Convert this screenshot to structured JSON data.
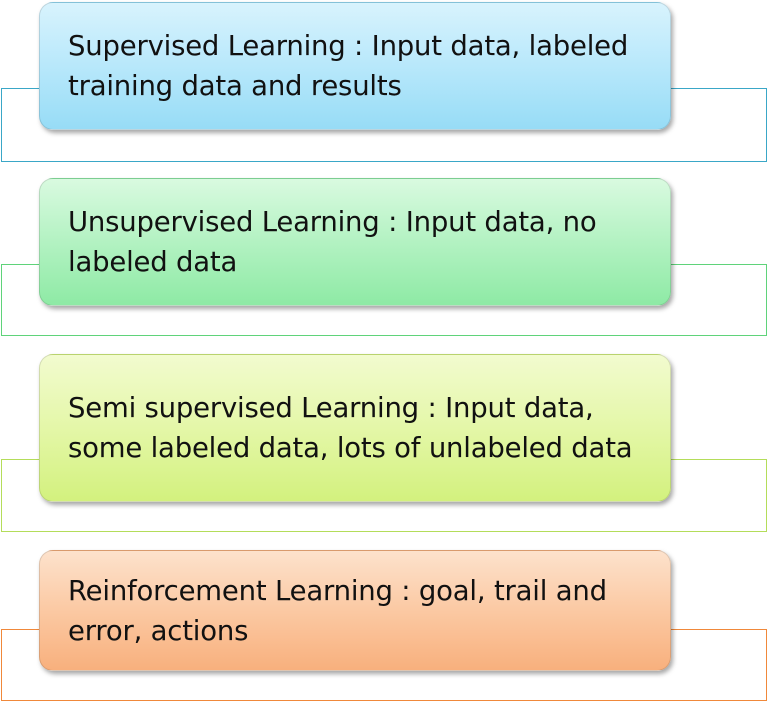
{
  "items": [
    {
      "text": "Supervised Learning : Input data, labeled training data and results"
    },
    {
      "text": "Unsupervised Learning : Input data, no labeled data"
    },
    {
      "text": "Semi supervised Learning : Input data, some labeled data, lots of unlabeled data"
    },
    {
      "text": "Reinforcement Learning : goal, trail and error, actions"
    }
  ]
}
